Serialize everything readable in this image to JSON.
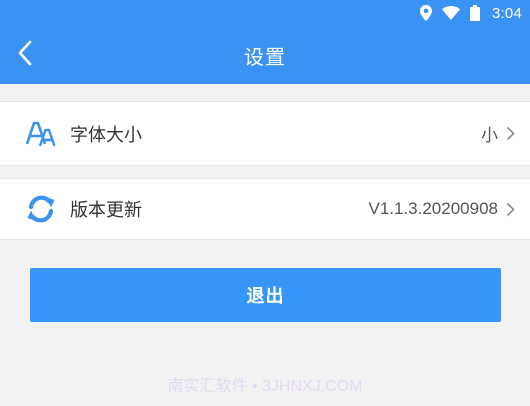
{
  "status_bar": {
    "time": "3:04",
    "icons": [
      "location-pin-icon",
      "wifi-icon",
      "battery-icon"
    ]
  },
  "app_bar": {
    "title": "设置",
    "back_icon": "chevron-left-icon"
  },
  "settings": [
    {
      "icon": "font-size-icon",
      "label": "字体大小",
      "value": "小"
    },
    {
      "icon": "refresh-icon",
      "label": "版本更新",
      "value": "V1.1.3.20200908"
    }
  ],
  "logout_label": "退出",
  "watermark": "南实汇软件 • 3JHNXJ.COM",
  "colors": {
    "primary": "#3a93f2",
    "button": "#3696f8",
    "background": "#f2f2f2"
  }
}
